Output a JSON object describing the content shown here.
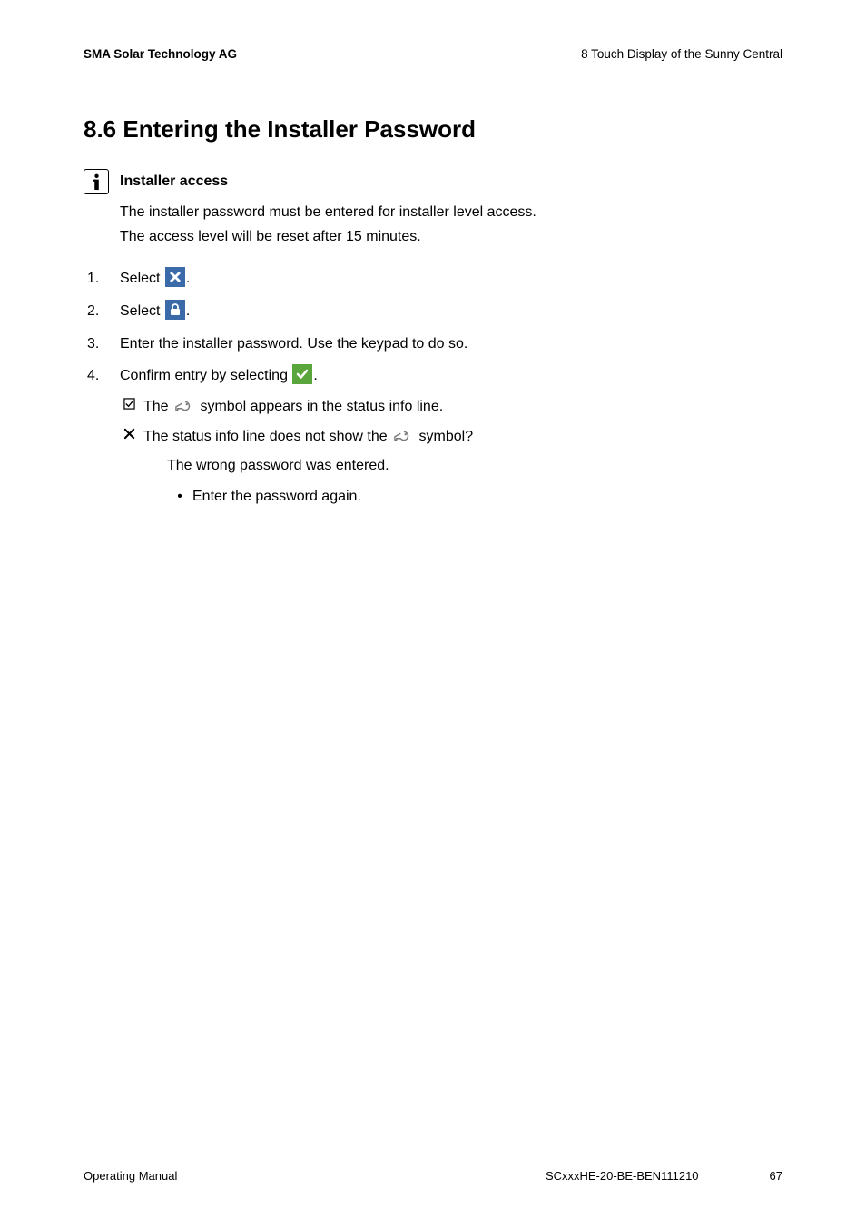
{
  "header": {
    "left": "SMA Solar Technology AG",
    "right": "8  Touch Display of the Sunny Central"
  },
  "section": {
    "heading": "8.6  Entering the Installer Password"
  },
  "info": {
    "title": "Installer access",
    "line1": "The installer password must be entered for installer level access.",
    "line2": "The access level will be reset after 15 minutes."
  },
  "steps": {
    "s1_a": "Select ",
    "s1_b": ".",
    "s2_a": "Select ",
    "s2_b": ".",
    "s3": "Enter the installer password. Use the keypad to do so.",
    "s4_a": "Confirm entry by selecting ",
    "s4_b": "."
  },
  "result_ok_a": "The ",
  "result_ok_b": " symbol appears in the status info line.",
  "result_fail_a": "The status info line does not show the ",
  "result_fail_b": " symbol?",
  "result_fail_explain": "The wrong password was entered.",
  "result_fail_action": "Enter the password again.",
  "footer": {
    "left": "Operating Manual",
    "doc": "SCxxxHE-20-BE-BEN111210",
    "page": "67"
  }
}
